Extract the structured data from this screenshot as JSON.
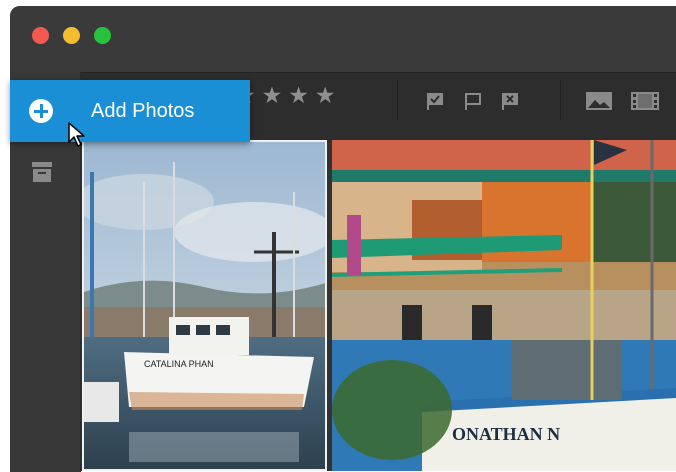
{
  "window": {
    "traffic_lights": [
      "close",
      "minimize",
      "zoom"
    ]
  },
  "toolbar": {
    "rating_stars": "★★★★",
    "flag_icons": [
      "flag-pick-icon",
      "flag-icon",
      "flag-reject-icon"
    ],
    "media_icons": [
      "photo-filter-icon",
      "video-filter-icon"
    ]
  },
  "add_photos": {
    "label": "Add Photos"
  },
  "sidebar": {
    "icons": [
      "archive-icon"
    ]
  },
  "colors": {
    "accent": "#1a8fd6",
    "window_bg": "#333333",
    "toolbar_bg": "#2d2d2d"
  },
  "photos": {
    "photo_2_boat_name": "ONATHAN N",
    "photo_1_boat_name": "CATALINA PHAN"
  }
}
